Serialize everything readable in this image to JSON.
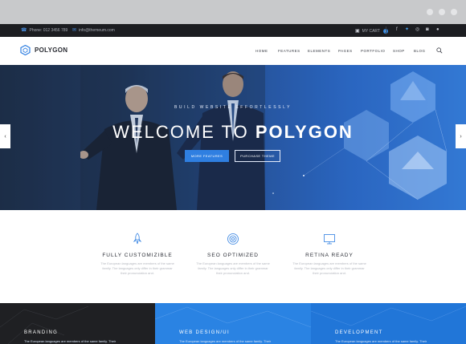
{
  "topbar": {
    "phone": "Phone: 012 3456 789",
    "email": "info@themeum.com",
    "cart_label": "MY CART",
    "cart_count": "0"
  },
  "social_icons": [
    "facebook-icon",
    "twitter-icon",
    "dribbble-icon",
    "instagram-icon",
    "flickr-icon"
  ],
  "brand": {
    "name": "POLYGON"
  },
  "nav": [
    "HOME",
    "FEATURES",
    "ELEMENTS",
    "PAGES",
    "PORTFOLIO",
    "SHOP",
    "BLOG"
  ],
  "hero": {
    "kicker": "BUILD WEBSITE EFFORTLESSLY",
    "title_prefix": "WELCOME TO",
    "title_brand": "POLYGON",
    "primary_button": "MORE FEATURES",
    "secondary_button": "PURCHASE THEME",
    "prev_arrow": "‹",
    "next_arrow": "›"
  },
  "features": [
    {
      "title": "FULLY CUSTOMIZIBLE",
      "icon": "rocket-icon",
      "lines": [
        "The European languages are members of the same",
        "family. The languages only differ in their grammar",
        "their pronunciation and."
      ]
    },
    {
      "title": "SEO OPTIMIZED",
      "icon": "target-icon",
      "lines": [
        "The European languages are members of the same",
        "family. The languages only differ in their grammar",
        "their pronunciation and."
      ]
    },
    {
      "title": "RETINA READY",
      "icon": "monitor-icon",
      "lines": [
        "The European languages are members of the same",
        "family. The languages only differ in their grammar",
        "their pronunciation and."
      ]
    }
  ],
  "tiles": [
    {
      "title": "BRANDING",
      "text": "The European languages are members of the same family. Their"
    },
    {
      "title": "WEB DESIGN/UI",
      "text": "The European languages are members of the same family. Their"
    },
    {
      "title": "DEVELOPMENT",
      "text": "The European languages are members of the same family. Their"
    }
  ],
  "colors": {
    "accent": "#2f7fe1",
    "topbar_bg": "#1c1d21",
    "tile_dark": "#1f2023",
    "tile_blue": "#2a83e3",
    "tile_blue_2": "#2176d8"
  }
}
